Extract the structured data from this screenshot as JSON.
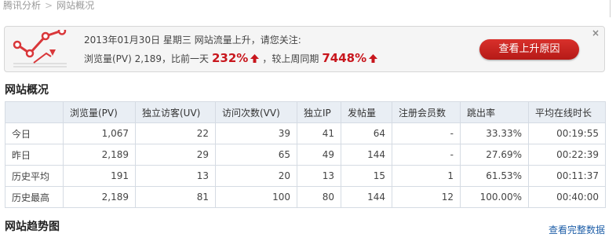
{
  "breadcrumb": {
    "items": [
      "腾讯分析",
      "网站概况"
    ],
    "separator": ">"
  },
  "alert": {
    "line1": "2013年01月30日 星期三 网站流量上升，请您关注:",
    "pv_text": "浏览量(PV) 2,189，比前一天",
    "day_change": "232%",
    "week_text": "，较上周同期",
    "week_change": "7448%",
    "button_label": "查看上升原因",
    "close_label": "×",
    "accent_color": "#c8161d"
  },
  "overview": {
    "title": "网站概况",
    "columns": [
      "",
      "浏览量(PV)",
      "独立访客(UV)",
      "访问次数(VV)",
      "独立IP",
      "发帖量",
      "注册会员数",
      "跳出率",
      "平均在线时长"
    ],
    "rows": [
      {
        "label": "今日",
        "cells": [
          "1,067",
          "22",
          "39",
          "41",
          "64",
          "-",
          "33.33%",
          "00:19:55"
        ]
      },
      {
        "label": "昨日",
        "cells": [
          "2,189",
          "29",
          "65",
          "49",
          "144",
          "-",
          "27.69%",
          "00:22:39"
        ]
      },
      {
        "label": "历史平均",
        "cells": [
          "191",
          "13",
          "20",
          "13",
          "15",
          "1",
          "61.53%",
          "00:11:37"
        ]
      },
      {
        "label": "历史最高",
        "cells": [
          "2,189",
          "81",
          "100",
          "80",
          "144",
          "12",
          "100.00%",
          "00:40:00"
        ]
      }
    ]
  },
  "trend": {
    "title": "网站趋势图",
    "more_link": "查看完整数据"
  }
}
